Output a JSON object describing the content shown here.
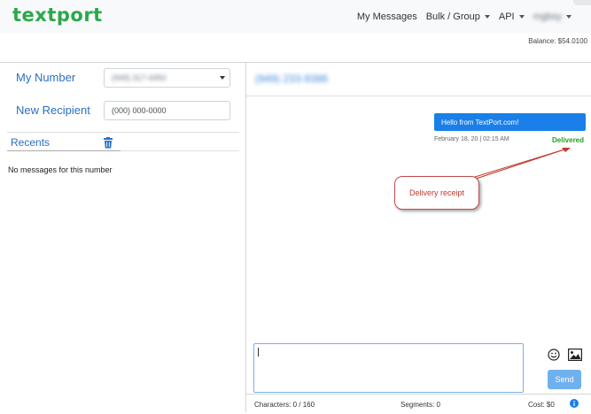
{
  "app": {
    "logo_text": "textport"
  },
  "nav": {
    "my_messages": "My Messages",
    "bulk_group": "Bulk / Group",
    "api": "API",
    "user_menu": "mgbsy"
  },
  "balance": "Balance: $54.0100",
  "left_panel": {
    "my_number_label": "My Number",
    "my_number_value": "(949) 317-4450",
    "new_recipient_label": "New Recipient",
    "new_recipient_placeholder": "(000) 000-0000",
    "recents_label": "Recents",
    "empty_text": "No messages for this number"
  },
  "chat": {
    "recipient": "(949) 233-9386",
    "messages": [
      {
        "text": "Hello from TextPort.com!",
        "timestamp": "February 18, 20 | 02:15 AM",
        "status": "Delivered"
      }
    ],
    "annotation": "Delivery receipt"
  },
  "compose": {
    "value": "",
    "send_label": "Send",
    "characters": "Characters: 0 / 160",
    "segments": "Segments: 0",
    "cost": "Cost: $0"
  },
  "icons": {
    "trash": "trash-icon",
    "emoji": "emoji-icon",
    "image": "image-icon",
    "info": "info-icon"
  },
  "colors": {
    "logo": "#2aa84a",
    "accent": "#2a6fc4",
    "bubble": "#1a7fe8",
    "delivered": "#22a022",
    "callout": "#c0392b",
    "send_button": "#6fb1ef"
  }
}
